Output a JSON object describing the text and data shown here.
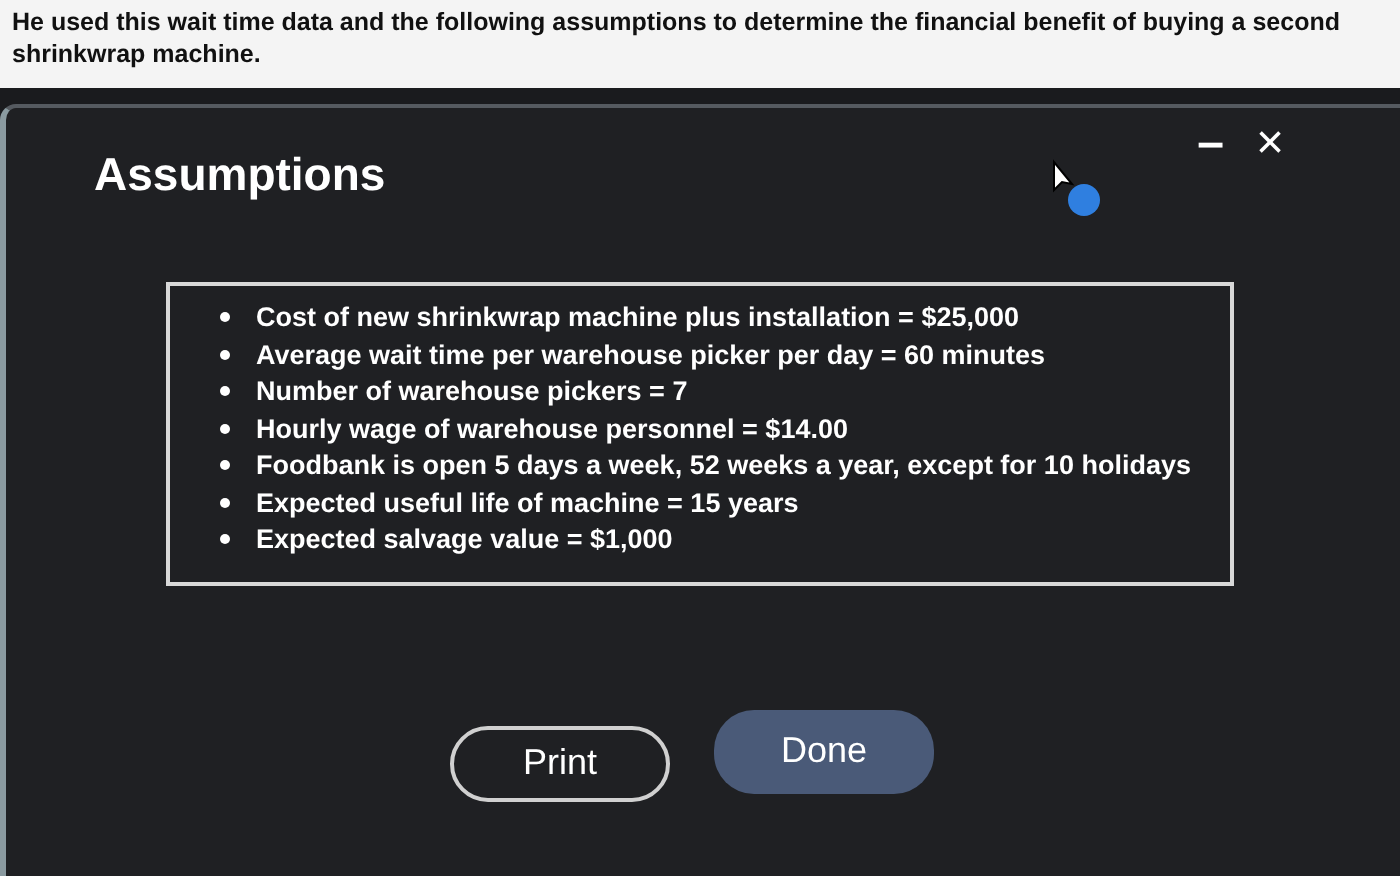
{
  "intro": "He used this wait time data and the following assumptions to determine the financial benefit of buying a second shrinkwrap machine.",
  "dialog": {
    "title": "Assumptions",
    "controls": [
      {
        "kind": "minimize",
        "label": "–"
      },
      {
        "kind": "close",
        "label": "×"
      }
    ],
    "assumptions": [
      "Cost of new shrinkwrap machine plus installation = $25,000",
      "Average wait time per warehouse picker per day = 60 minutes",
      "Number of warehouse pickers = 7",
      "Hourly wage of warehouse personnel = $14.00",
      "Foodbank is open 5 days a week, 52 weeks a year, except for 10 holidays",
      "Expected useful life of machine = 15 years",
      "Expected salvage value = $1,000"
    ],
    "buttons": [
      {
        "label": "Print",
        "kind": "outlined"
      },
      {
        "label": "Done",
        "kind": "filled"
      }
    ]
  }
}
